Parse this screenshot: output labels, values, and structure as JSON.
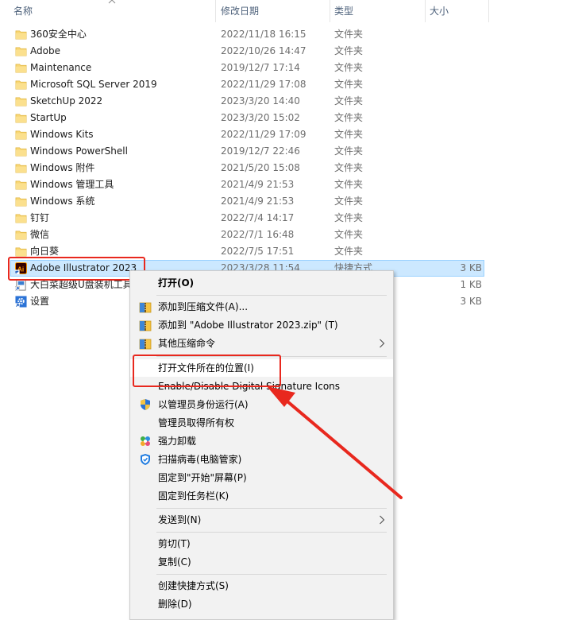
{
  "header": {
    "name_label": "名称",
    "date_label": "修改日期",
    "type_label": "类型",
    "size_label": "大小"
  },
  "rows": [
    {
      "name": "360安全中心",
      "date": "2022/11/18 16:15",
      "type": "文件夹",
      "size": "",
      "icon": "folder-icon"
    },
    {
      "name": "Adobe",
      "date": "2022/10/26 14:47",
      "type": "文件夹",
      "size": "",
      "icon": "folder-icon"
    },
    {
      "name": "Maintenance",
      "date": "2019/12/7 17:14",
      "type": "文件夹",
      "size": "",
      "icon": "folder-icon"
    },
    {
      "name": "Microsoft SQL Server 2019",
      "date": "2022/11/29 17:08",
      "type": "文件夹",
      "size": "",
      "icon": "folder-icon"
    },
    {
      "name": "SketchUp 2022",
      "date": "2023/3/20 14:40",
      "type": "文件夹",
      "size": "",
      "icon": "folder-icon"
    },
    {
      "name": "StartUp",
      "date": "2023/3/20 15:02",
      "type": "文件夹",
      "size": "",
      "icon": "folder-icon"
    },
    {
      "name": "Windows Kits",
      "date": "2022/11/29 17:09",
      "type": "文件夹",
      "size": "",
      "icon": "folder-icon"
    },
    {
      "name": "Windows PowerShell",
      "date": "2019/12/7 22:46",
      "type": "文件夹",
      "size": "",
      "icon": "folder-icon"
    },
    {
      "name": "Windows 附件",
      "date": "2021/5/20 15:08",
      "type": "文件夹",
      "size": "",
      "icon": "folder-icon"
    },
    {
      "name": "Windows 管理工具",
      "date": "2021/4/9 21:53",
      "type": "文件夹",
      "size": "",
      "icon": "folder-icon"
    },
    {
      "name": "Windows 系统",
      "date": "2021/4/9 21:53",
      "type": "文件夹",
      "size": "",
      "icon": "folder-icon"
    },
    {
      "name": "钉钉",
      "date": "2022/7/4 14:17",
      "type": "文件夹",
      "size": "",
      "icon": "folder-icon"
    },
    {
      "name": "微信",
      "date": "2022/7/1 16:48",
      "type": "文件夹",
      "size": "",
      "icon": "folder-icon"
    },
    {
      "name": "向日葵",
      "date": "2022/7/5 17:51",
      "type": "文件夹",
      "size": "",
      "icon": "folder-icon"
    },
    {
      "name": "Adobe Illustrator 2023",
      "date": "2023/3/28 11:54",
      "type": "快捷方式",
      "size": "3 KB",
      "icon": "illustrator-shortcut-icon"
    },
    {
      "name": "大白菜超级U盘装机工具",
      "date": "",
      "type": "",
      "size": "1 KB",
      "icon": "shortcut-icon"
    },
    {
      "name": "设置",
      "date": "",
      "type": "",
      "size": "3 KB",
      "icon": "settings-shortcut-icon"
    }
  ],
  "selected_index": 14,
  "context_menu": {
    "items": [
      {
        "label": "打开(O)",
        "icon": "",
        "submenu": false,
        "bold": true
      },
      {
        "label": "添加到压缩文件(A)...",
        "icon": "archive-icon",
        "submenu": false
      },
      {
        "label": "添加到 \"Adobe Illustrator 2023.zip\" (T)",
        "icon": "archive-icon",
        "submenu": false
      },
      {
        "label": "其他压缩命令",
        "icon": "archive-icon",
        "submenu": true
      },
      {
        "label": "打开文件所在的位置(I)",
        "icon": "",
        "submenu": false
      },
      {
        "label": "Enable/Disable Digital Signature Icons",
        "icon": "",
        "submenu": false
      },
      {
        "label": "以管理员身份运行(A)",
        "icon": "uac-shield-icon",
        "submenu": false
      },
      {
        "label": "管理员取得所有权",
        "icon": "",
        "submenu": false
      },
      {
        "label": "强力卸载",
        "icon": "uninstall-icon",
        "submenu": false
      },
      {
        "label": "扫描病毒(电脑管家)",
        "icon": "pc-manager-shield-icon",
        "submenu": false
      },
      {
        "label": "固定到\"开始\"屏幕(P)",
        "icon": "",
        "submenu": false
      },
      {
        "label": "固定到任务栏(K)",
        "icon": "",
        "submenu": false
      },
      {
        "label": "发送到(N)",
        "icon": "",
        "submenu": true
      },
      {
        "label": "剪切(T)",
        "icon": "",
        "submenu": false
      },
      {
        "label": "复制(C)",
        "icon": "",
        "submenu": false
      },
      {
        "label": "创建快捷方式(S)",
        "icon": "",
        "submenu": false
      },
      {
        "label": "删除(D)",
        "icon": "",
        "submenu": false
      }
    ],
    "highlighted_index": 4
  },
  "colors": {
    "selection_fill": "#cce8ff",
    "selection_border": "#99d1ff",
    "annotation_red": "#e8281e",
    "folder_yellow": "#f8d775"
  }
}
